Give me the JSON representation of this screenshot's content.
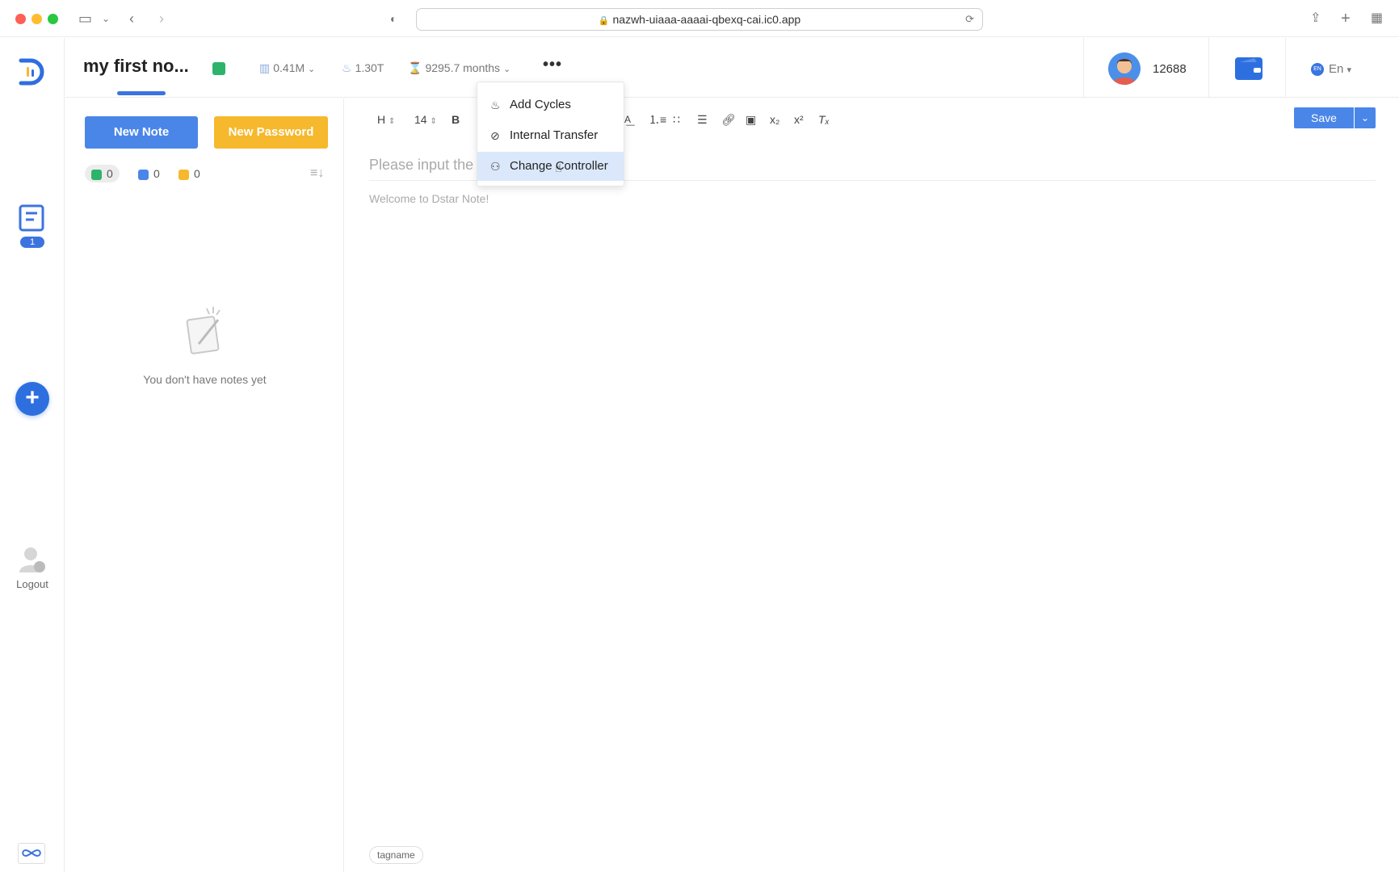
{
  "browser": {
    "url": "nazwh-uiaaa-aaaai-qbexq-cai.ic0.app"
  },
  "rail": {
    "notes_badge": "1",
    "logout_label": "Logout"
  },
  "header": {
    "note_title": "my first no...",
    "stat_storage": "0.41M",
    "stat_cycles": "1.30T",
    "stat_duration": "9295.7 months",
    "balance": "12688",
    "language": "En"
  },
  "notes": {
    "new_note_label": "New Note",
    "new_password_label": "New Password",
    "counters": [
      "0",
      "0",
      "0"
    ],
    "empty_text": "You don't have notes yet"
  },
  "editor": {
    "toolbar": {
      "heading": "H",
      "font_size": "14",
      "bold": "B"
    },
    "save_label": "Save",
    "title_placeholder": "Please input the title",
    "body_text": "Welcome to Dstar Note!",
    "tag": "tagname"
  },
  "menu": {
    "items": [
      "Add Cycles",
      "Internal Transfer",
      "Change Controller"
    ],
    "active_index": 2
  },
  "colors": {
    "accent": "#4a86e8",
    "warning": "#f6b82c",
    "success": "#2db46a"
  }
}
